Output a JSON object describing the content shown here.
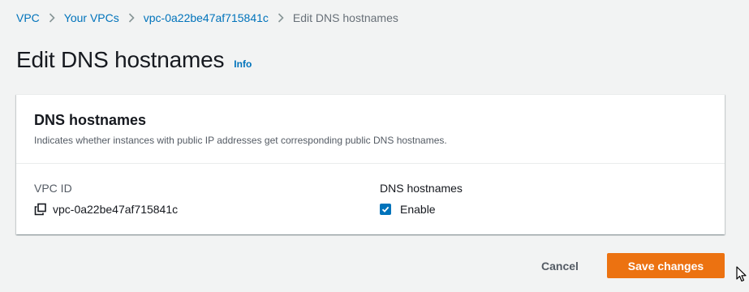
{
  "breadcrumb": {
    "items": [
      {
        "label": "VPC"
      },
      {
        "label": "Your VPCs"
      },
      {
        "label": "vpc-0a22be47af715841c"
      },
      {
        "label": "Edit DNS hostnames"
      }
    ]
  },
  "page": {
    "title": "Edit DNS hostnames",
    "info_label": "Info"
  },
  "panel": {
    "title": "DNS hostnames",
    "description": "Indicates whether instances with public IP addresses get corresponding public DNS hostnames.",
    "vpc_id_label": "VPC ID",
    "vpc_id_value": "vpc-0a22be47af715841c",
    "dns_label": "DNS hostnames",
    "enable_label": "Enable",
    "enable_checked": true
  },
  "actions": {
    "cancel_label": "Cancel",
    "save_label": "Save changes"
  },
  "colors": {
    "link": "#0073bb",
    "primary_button": "#ec7211",
    "page_background": "#f2f3f3"
  },
  "icons": {
    "separator": "chevron-right-icon",
    "copy": "copy-icon",
    "checkbox": "checkmark-icon",
    "cursor": "mouse-pointer-icon"
  }
}
